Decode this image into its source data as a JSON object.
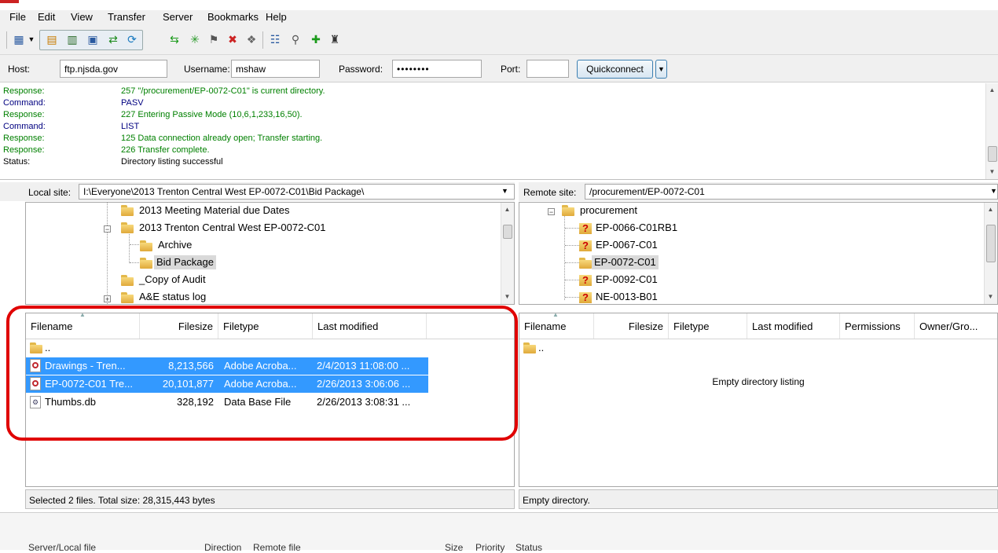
{
  "menu": [
    "File",
    "Edit",
    "View",
    "Transfer",
    "Server",
    "Bookmarks",
    "Help"
  ],
  "quickconnect": {
    "host_label": "Host:",
    "host_value": "ftp.njsda.gov",
    "username_label": "Username:",
    "username_value": "mshaw",
    "password_label": "Password:",
    "password_value": "••••••••",
    "port_label": "Port:",
    "port_value": "",
    "button_label": "Quickconnect"
  },
  "log": [
    {
      "kind": "Response:",
      "text": "257 \"/procurement/EP-0072-C01\" is current directory.",
      "color": "#008000"
    },
    {
      "kind": "Command:",
      "text": "PASV",
      "color": "#000080"
    },
    {
      "kind": "Response:",
      "text": "227 Entering Passive Mode (10,6,1,233,16,50).",
      "color": "#008000"
    },
    {
      "kind": "Command:",
      "text": "LIST",
      "color": "#000080"
    },
    {
      "kind": "Response:",
      "text": "125 Data connection already open; Transfer starting.",
      "color": "#008000"
    },
    {
      "kind": "Response:",
      "text": "226 Transfer complete.",
      "color": "#008000"
    },
    {
      "kind": "Status:",
      "text": "Directory listing successful",
      "color": "#000000"
    }
  ],
  "local": {
    "site_label": "Local site:",
    "site_path": "I:\\Everyone\\2013 Trenton Central West EP-0072-C01\\Bid Package\\",
    "tree": [
      "2013 Meeting Material due Dates",
      "2013 Trenton Central West EP-0072-C01",
      "Archive",
      "Bid Package",
      "_Copy of Audit",
      "A&E status log"
    ],
    "columns": [
      "Filename",
      "Filesize",
      "Filetype",
      "Last modified"
    ],
    "files": [
      {
        "name": "..",
        "size": "",
        "type": "",
        "modified": ""
      },
      {
        "name": "Drawings - Tren...",
        "size": "8,213,566",
        "type": "Adobe Acroba...",
        "modified": "2/4/2013 11:08:00 ..."
      },
      {
        "name": "EP-0072-C01 Tre...",
        "size": "20,101,877",
        "type": "Adobe Acroba...",
        "modified": "2/26/2013 3:06:06 ..."
      },
      {
        "name": "Thumbs.db",
        "size": "328,192",
        "type": "Data Base File",
        "modified": "2/26/2013 3:08:31 ..."
      }
    ],
    "status": "Selected 2 files. Total size: 28,315,443 bytes"
  },
  "remote": {
    "site_label": "Remote site:",
    "site_path": "/procurement/EP-0072-C01",
    "tree": [
      "procurement",
      "EP-0066-C01RB1",
      "EP-0067-C01",
      "EP-0072-C01",
      "EP-0092-C01",
      "NE-0013-B01"
    ],
    "columns": [
      "Filename",
      "Filesize",
      "Filetype",
      "Last modified",
      "Permissions",
      "Owner/Gro..."
    ],
    "parent": "..",
    "empty_message": "Empty directory listing",
    "status": "Empty directory."
  },
  "queue_columns": [
    "Server/Local file",
    "Direction",
    "Remote file",
    "Size",
    "Priority",
    "Status"
  ],
  "colors": {
    "selection": "#3399ff",
    "highlight": "#e00000"
  }
}
